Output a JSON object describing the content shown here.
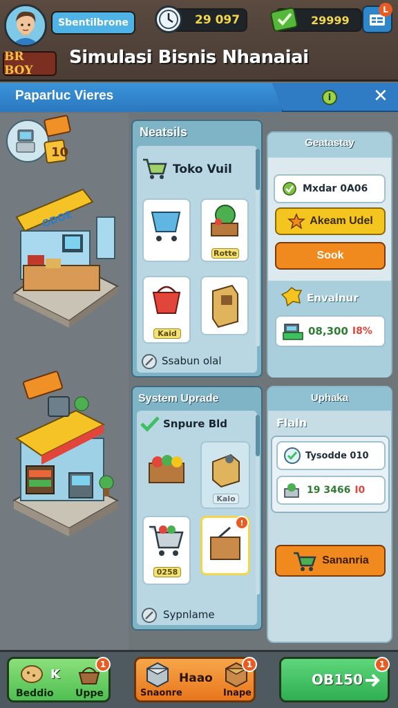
{
  "header": {
    "badge": "BR BOY",
    "player_name": "Sbentilbrone",
    "time_value": "29 097",
    "money_value": "29999",
    "menu_badge": "L",
    "title": "Simulasi Bisnis Nhanaiai"
  },
  "subheader": {
    "title": "Paparluc Vieres",
    "info": "i",
    "close": "✕"
  },
  "world": {
    "kiosk_sign": "10",
    "store_sign": "ODOE"
  },
  "upgrades_panel": {
    "title": "Neatsils",
    "store_label": "Toko Vuil",
    "item_tags": [
      "Rotte",
      "Kaid"
    ],
    "footer": "Ssabun olal"
  },
  "gateway_panel": {
    "title": "Geatastay",
    "row_label": "Mxdar 0A06",
    "yellow_button": "Akeam Udel",
    "orange_button": "Sook",
    "section_label": "Envalnur",
    "value": "08,300",
    "value_suffix": "I8%"
  },
  "system_panel": {
    "title": "System Uprade",
    "subtitle": "Snpure Bld",
    "item_tags": [
      "Kalo",
      "0258"
    ],
    "footer": "Sypnlame"
  },
  "plan_panel": {
    "title": "Uphaka",
    "subtitle": "Flaln",
    "row1": "Tysodde 010",
    "row2_value": "19 3466",
    "row2_suffix": "I0",
    "button": "Sananria"
  },
  "bottom_bar": {
    "left_label_1": "Beddio",
    "left_label_2": "Uppe",
    "left_key": "K",
    "left_badge": "1",
    "mid_title": "Haao",
    "mid_label_1": "Snaonre",
    "mid_label_2": "Inape",
    "mid_badge": "1",
    "right_value": "OB150",
    "right_badge": "1"
  },
  "colors": {
    "accent_blue": "#2f7bc4",
    "green": "#3fbf63",
    "orange": "#f08a1e",
    "yellow": "#f5c51f"
  }
}
